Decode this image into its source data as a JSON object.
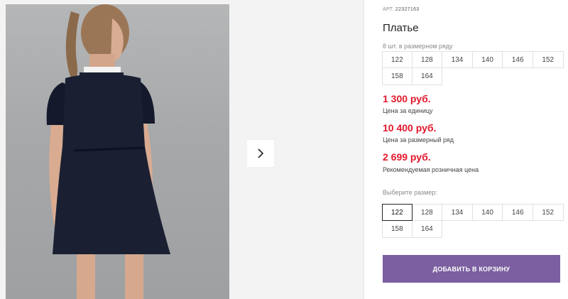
{
  "gallery": {
    "photo_alt": "",
    "next_icon": "chevron-right-icon"
  },
  "product": {
    "art_prefix": "АРТ.",
    "art_number": "22327163",
    "title": "Платье",
    "pack_note": "8 шт. в размерном ряду",
    "pack_sizes": [
      "122",
      "128",
      "134",
      "140",
      "146",
      "152",
      "158",
      "164"
    ]
  },
  "prices": [
    {
      "value": "1 300 руб.",
      "label": "Цена за единицу"
    },
    {
      "value": "10 400 руб.",
      "label": "Цена за размерный ряд"
    },
    {
      "value": "2 699 руб.",
      "label": "Рекомендуемая розничная цена"
    }
  ],
  "size_picker": {
    "label": "Выберите размер:",
    "sizes": [
      "122",
      "128",
      "134",
      "140",
      "146",
      "152",
      "158",
      "164"
    ],
    "selected": "122"
  },
  "cart_button": {
    "label": "ДОБАВИТЬ В КОРЗИНУ"
  },
  "colors": {
    "price_red": "#e2172b",
    "button_purple": "#7b5fa0"
  }
}
